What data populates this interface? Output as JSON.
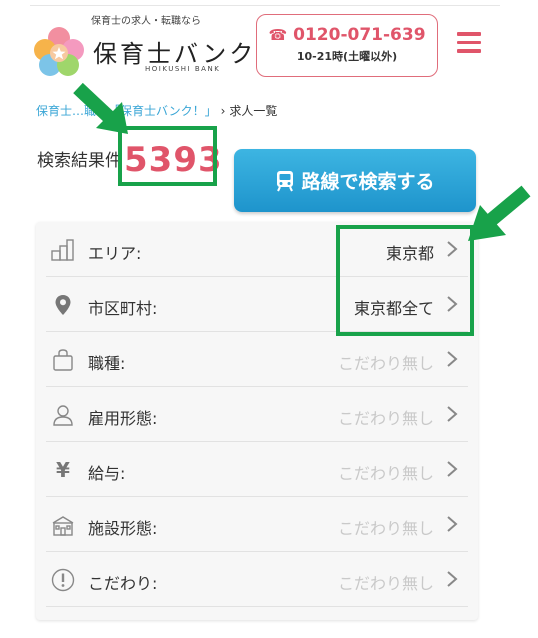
{
  "header": {
    "tagline": "保育士の求人・転職なら",
    "brand_name": "保育士バンク",
    "brand_sub": "HOIKUSHI BANK",
    "phone_number": "0120-071-639",
    "phone_hours": "10-21時(土曜以外)",
    "menu_icon": "hamburger-icon",
    "accent_color": "#e0556a"
  },
  "breadcrumb": {
    "link_text": "保育士…職の「保育士バンク！」",
    "current": "求人一覧"
  },
  "results": {
    "label": "検索結果件",
    "count": "5393"
  },
  "route_button": {
    "label": "路線で検索する",
    "icon": "train-icon",
    "color": "#1e94cc"
  },
  "filters": [
    {
      "label": "エリア:",
      "value": "東京都",
      "state": "set",
      "icon": "area-icon"
    },
    {
      "label": "市区町村:",
      "value": "東京都全て",
      "state": "set",
      "icon": "location-pin-icon"
    },
    {
      "label": "職種:",
      "value": "こだわり無し",
      "state": "unset",
      "icon": "bag-icon"
    },
    {
      "label": "雇用形態:",
      "value": "こだわり無し",
      "state": "unset",
      "icon": "person-icon"
    },
    {
      "label": "給与:",
      "value": "こだわり無し",
      "state": "unset",
      "icon": "yen-icon"
    },
    {
      "label": "施設形態:",
      "value": "こだわり無し",
      "state": "unset",
      "icon": "facility-icon"
    },
    {
      "label": "こだわり:",
      "value": "こだわり無し",
      "state": "unset",
      "icon": "exclamation-circle-icon"
    }
  ],
  "annotation_color": "#18a24a"
}
